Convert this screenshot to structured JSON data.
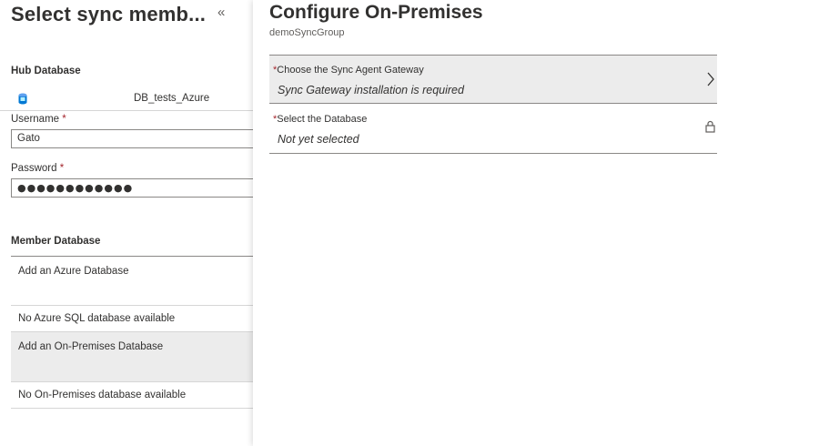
{
  "left_blade": {
    "title": "Select sync memb...",
    "collapse_glyph": "«",
    "hub_heading": "Hub Database",
    "hub_db_name": "DB_tests_Azure",
    "hub_db_icon": "sql-database-icon",
    "username_label": "Username",
    "username_value": "Gato",
    "password_label": "Password",
    "password_value": "●●●●●●●●●●●●",
    "required_mark": "*",
    "member_heading": "Member Database",
    "member_items": [
      {
        "label": "Add an Azure Database"
      },
      {
        "label": "No Azure SQL database available"
      },
      {
        "label": "Add an On-Premises Database"
      },
      {
        "label": "No On-Premises database available"
      }
    ]
  },
  "right_blade": {
    "title": "Configure On-Premises",
    "subtitle": "demoSyncGroup",
    "required_mark": "*",
    "rows": [
      {
        "label": "Choose the Sync Agent Gateway",
        "value": "Sync Gateway installation is required",
        "icon": "chevron-right-icon"
      },
      {
        "label": "Select the Database",
        "value": "Not yet selected",
        "icon": "lock-icon"
      }
    ]
  },
  "colors": {
    "selected_row_bg": "#ececec",
    "required": "#a4262c",
    "text": "#323130"
  }
}
